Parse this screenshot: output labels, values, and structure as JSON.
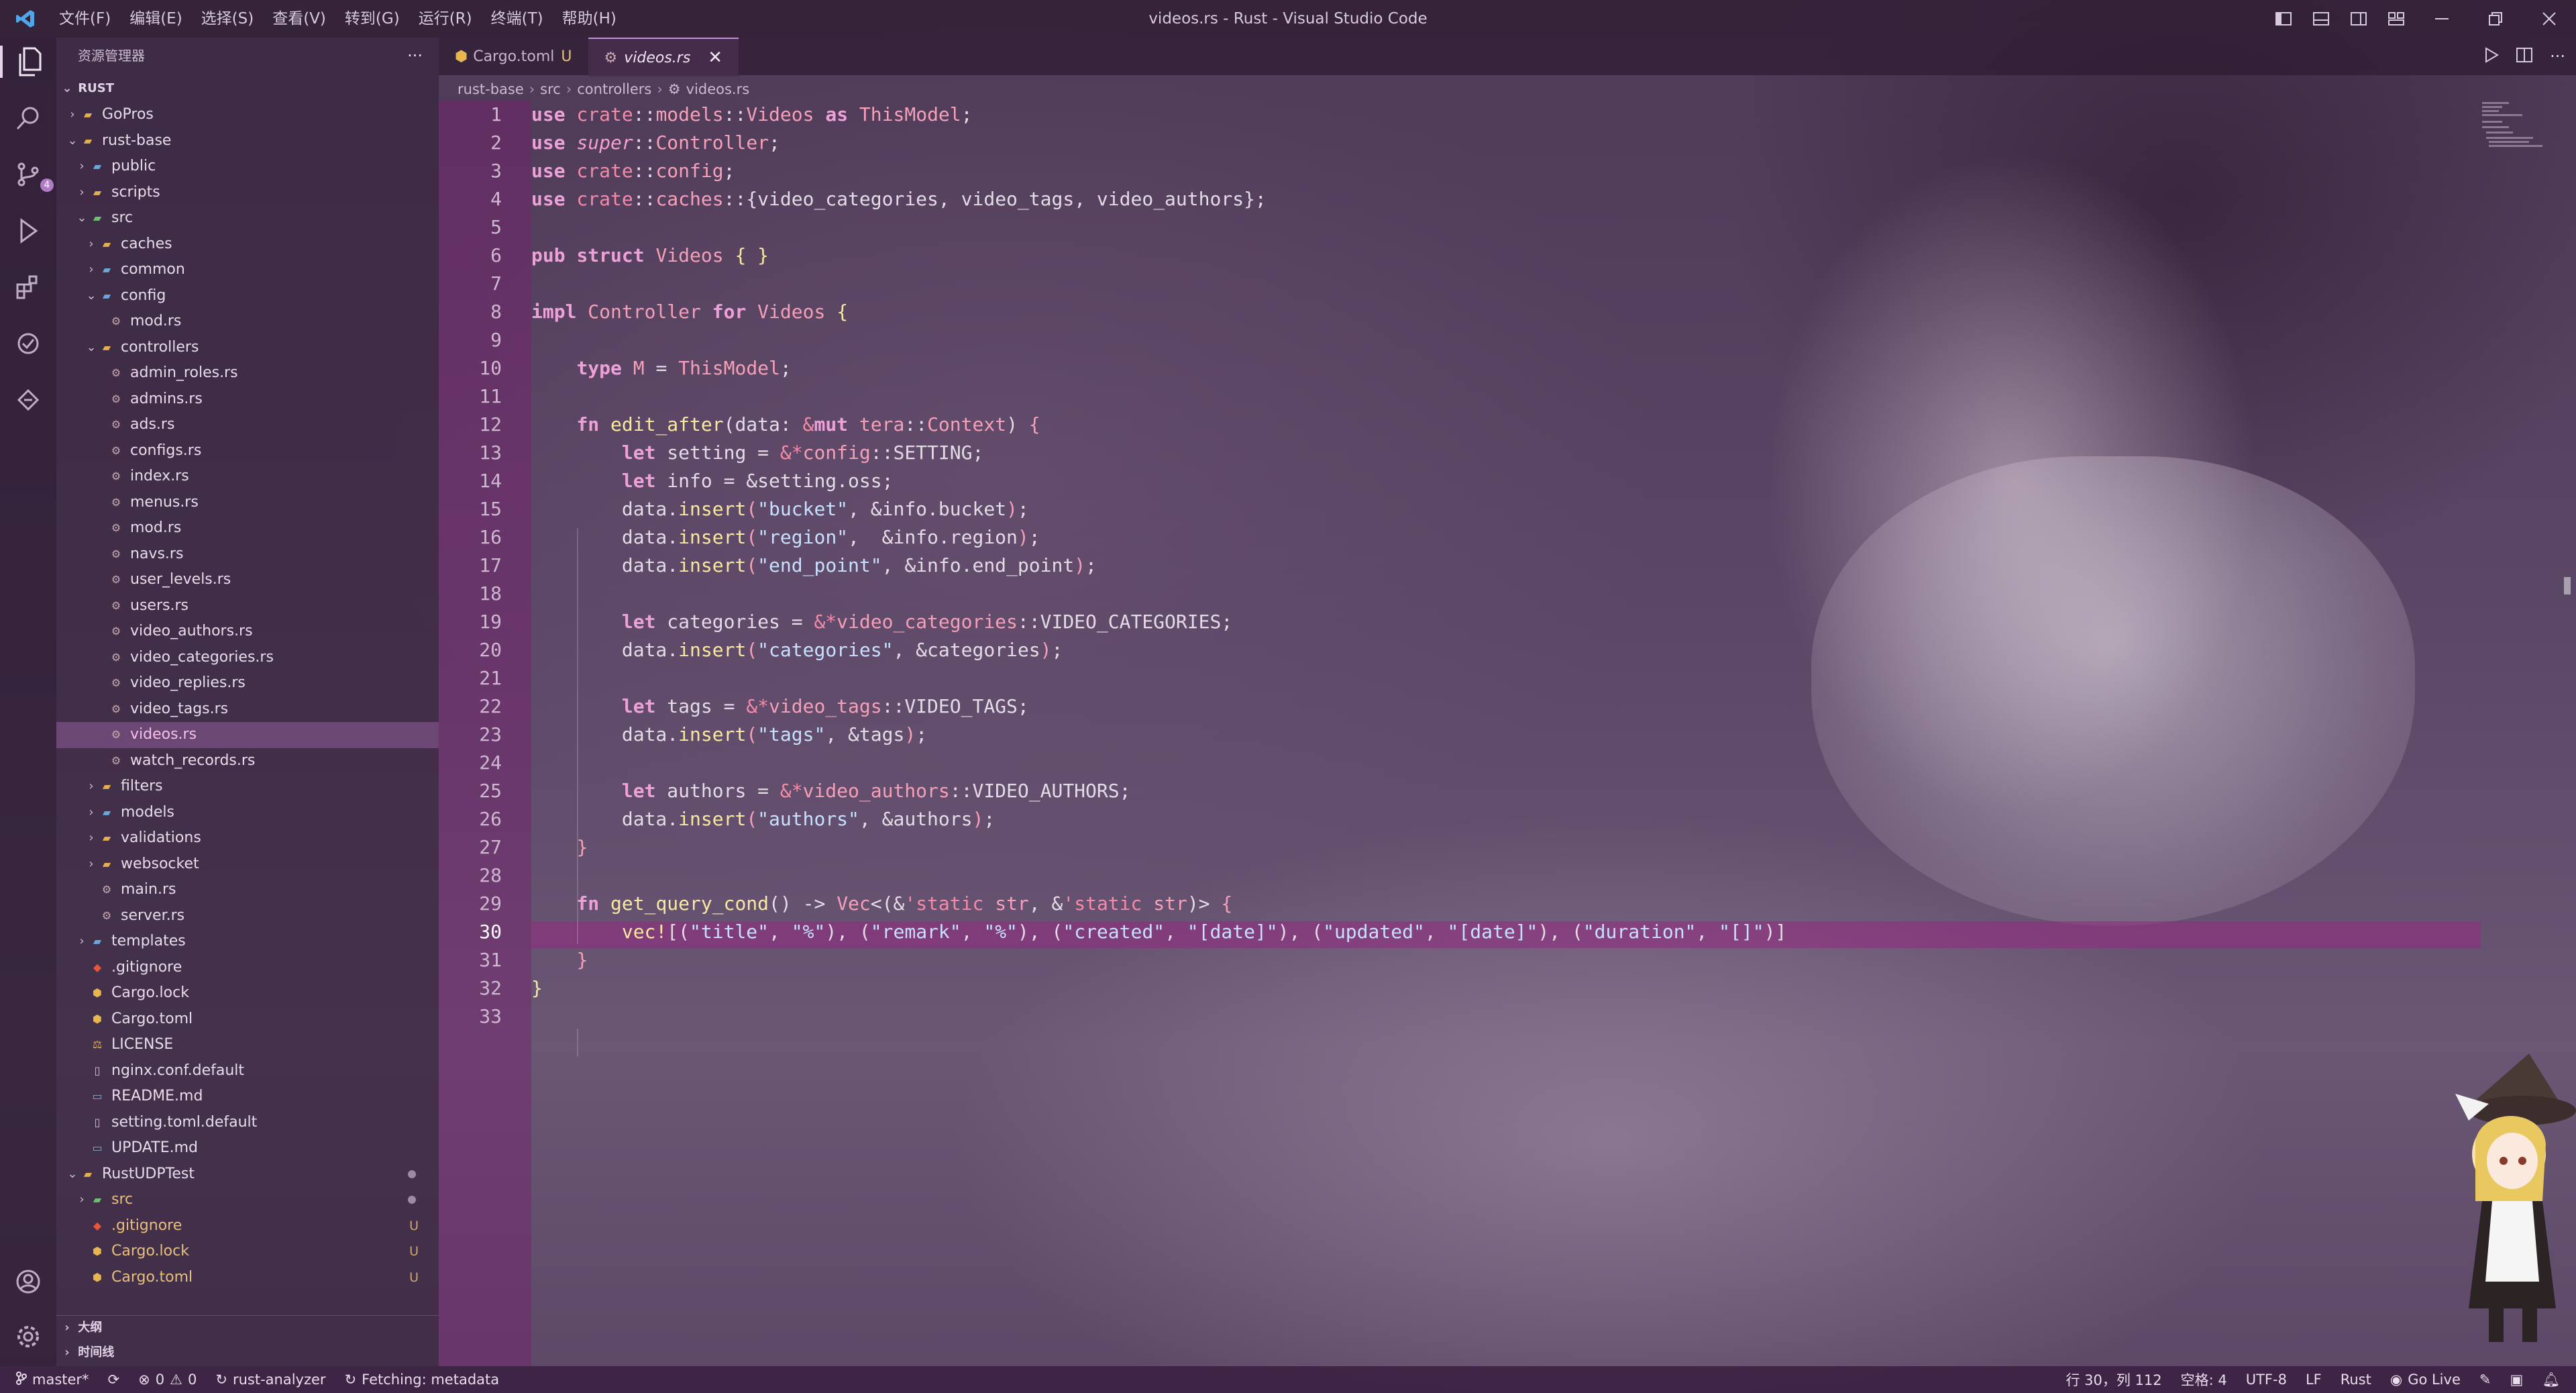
{
  "window": {
    "title": "videos.rs - Rust - Visual Studio Code",
    "menu": [
      "文件(F)",
      "编辑(E)",
      "选择(S)",
      "查看(V)",
      "转到(G)",
      "运行(R)",
      "终端(T)",
      "帮助(H)"
    ]
  },
  "sidebar": {
    "header": "资源管理器",
    "more": "···",
    "root": "RUST",
    "tree": [
      {
        "label": "GoPros",
        "depth": 1,
        "type": "folder",
        "open": false
      },
      {
        "label": "rust-base",
        "depth": 1,
        "type": "folder",
        "open": true
      },
      {
        "label": "public",
        "depth": 2,
        "type": "folder-special",
        "open": false
      },
      {
        "label": "scripts",
        "depth": 2,
        "type": "folder",
        "open": false
      },
      {
        "label": "src",
        "depth": 2,
        "type": "folder-src",
        "open": true
      },
      {
        "label": "caches",
        "depth": 3,
        "type": "folder",
        "open": false
      },
      {
        "label": "common",
        "depth": 3,
        "type": "folder-special",
        "open": false
      },
      {
        "label": "config",
        "depth": 3,
        "type": "folder-special",
        "open": true
      },
      {
        "label": "mod.rs",
        "depth": 4,
        "type": "rs"
      },
      {
        "label": "controllers",
        "depth": 3,
        "type": "folder",
        "open": true
      },
      {
        "label": "admin_roles.rs",
        "depth": 4,
        "type": "rs"
      },
      {
        "label": "admins.rs",
        "depth": 4,
        "type": "rs"
      },
      {
        "label": "ads.rs",
        "depth": 4,
        "type": "rs"
      },
      {
        "label": "configs.rs",
        "depth": 4,
        "type": "rs"
      },
      {
        "label": "index.rs",
        "depth": 4,
        "type": "rs"
      },
      {
        "label": "menus.rs",
        "depth": 4,
        "type": "rs"
      },
      {
        "label": "mod.rs",
        "depth": 4,
        "type": "rs"
      },
      {
        "label": "navs.rs",
        "depth": 4,
        "type": "rs"
      },
      {
        "label": "user_levels.rs",
        "depth": 4,
        "type": "rs"
      },
      {
        "label": "users.rs",
        "depth": 4,
        "type": "rs"
      },
      {
        "label": "video_authors.rs",
        "depth": 4,
        "type": "rs"
      },
      {
        "label": "video_categories.rs",
        "depth": 4,
        "type": "rs"
      },
      {
        "label": "video_replies.rs",
        "depth": 4,
        "type": "rs"
      },
      {
        "label": "video_tags.rs",
        "depth": 4,
        "type": "rs"
      },
      {
        "label": "videos.rs",
        "depth": 4,
        "type": "rs",
        "selected": true
      },
      {
        "label": "watch_records.rs",
        "depth": 4,
        "type": "rs"
      },
      {
        "label": "filters",
        "depth": 3,
        "type": "folder",
        "open": false
      },
      {
        "label": "models",
        "depth": 3,
        "type": "folder-special",
        "open": false
      },
      {
        "label": "validations",
        "depth": 3,
        "type": "folder",
        "open": false
      },
      {
        "label": "websocket",
        "depth": 3,
        "type": "folder",
        "open": false
      },
      {
        "label": "main.rs",
        "depth": 3,
        "type": "rs"
      },
      {
        "label": "server.rs",
        "depth": 3,
        "type": "rs"
      },
      {
        "label": "templates",
        "depth": 2,
        "type": "folder-special",
        "open": false
      },
      {
        "label": ".gitignore",
        "depth": 2,
        "type": "git"
      },
      {
        "label": "Cargo.lock",
        "depth": 2,
        "type": "cargo"
      },
      {
        "label": "Cargo.toml",
        "depth": 2,
        "type": "cargo"
      },
      {
        "label": "LICENSE",
        "depth": 2,
        "type": "license"
      },
      {
        "label": "nginx.conf.default",
        "depth": 2,
        "type": "file"
      },
      {
        "label": "README.md",
        "depth": 2,
        "type": "md"
      },
      {
        "label": "setting.toml.default",
        "depth": 2,
        "type": "file"
      },
      {
        "label": "UPDATE.md",
        "depth": 2,
        "type": "md"
      },
      {
        "label": "RustUDPTest",
        "depth": 1,
        "type": "folder",
        "open": true,
        "status": "dot"
      },
      {
        "label": "src",
        "depth": 2,
        "type": "folder-src",
        "open": false,
        "status": "dot",
        "modified": true
      },
      {
        "label": ".gitignore",
        "depth": 2,
        "type": "git",
        "status": "U",
        "modified": true
      },
      {
        "label": "Cargo.lock",
        "depth": 2,
        "type": "cargo",
        "status": "U",
        "modified": true
      },
      {
        "label": "Cargo.toml",
        "depth": 2,
        "type": "cargo",
        "status": "U",
        "modified": true
      }
    ],
    "outline": "大纲",
    "timeline": "时间线"
  },
  "tabs": [
    {
      "label": "Cargo.toml",
      "status": "U",
      "active": false
    },
    {
      "label": "videos.rs",
      "close": "✕",
      "active": true
    }
  ],
  "breadcrumb": [
    "rust-base",
    "src",
    "controllers",
    "videos.rs"
  ],
  "editor": {
    "current_line": 30,
    "lines": [
      "1",
      "2",
      "3",
      "4",
      "5",
      "6",
      "7",
      "8",
      "9",
      "10",
      "11",
      "12",
      "13",
      "14",
      "15",
      "16",
      "17",
      "18",
      "19",
      "20",
      "21",
      "22",
      "23",
      "24",
      "25",
      "26",
      "27",
      "28",
      "29",
      "30",
      "31",
      "32",
      "33"
    ]
  },
  "status": {
    "branch": "master*",
    "sync_icon": "sync-icon",
    "errors": "0",
    "warnings": "0",
    "analyzer": "rust-analyzer",
    "fetching": "Fetching: metadata",
    "position": "行 30，列 112",
    "spaces": "空格: 4",
    "encoding": "UTF-8",
    "eol": "LF",
    "language": "Rust",
    "golive": "Go Live"
  },
  "colors": {
    "accent": "#c590d5",
    "gutter": "#7a1e6e",
    "current_line": "#96288a"
  }
}
